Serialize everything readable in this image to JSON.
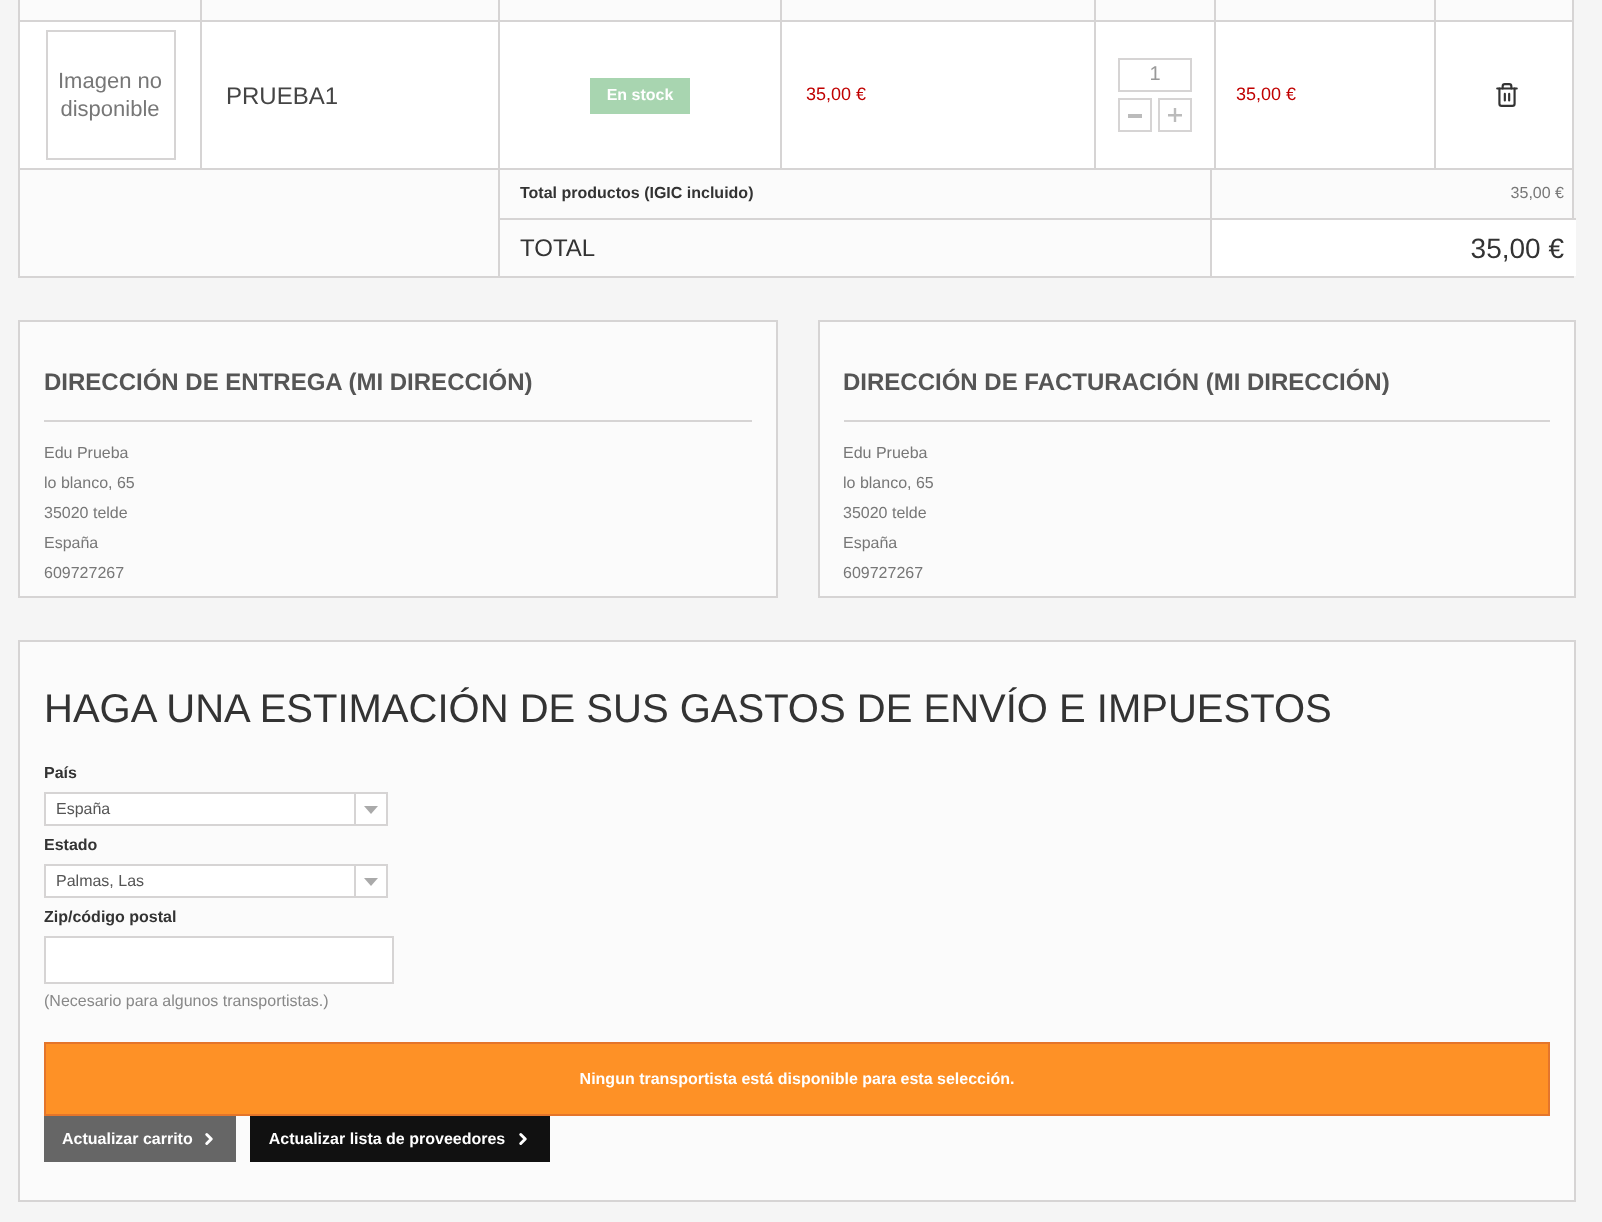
{
  "cart": {
    "items": [
      {
        "image_text": "Imagen no disponible",
        "description": "PRUEBA1",
        "availability": "En stock",
        "unit_price": "35,00 €",
        "quantity": "1",
        "total": "35,00 €"
      }
    ],
    "subtotal": {
      "label": "Total productos (IGIC incluido)",
      "value": "35,00 €"
    },
    "total": {
      "label": "TOTAL",
      "value": "35,00 €"
    }
  },
  "addresses": [
    {
      "title": "DIRECCIÓN DE ENTREGA (MI DIRECCIÓN)",
      "lines": [
        "Edu Prueba",
        "lo blanco, 65",
        "35020 telde",
        "España",
        "609727267"
      ]
    },
    {
      "title": "DIRECCIÓN DE FACTURACIÓN (MI DIRECCIÓN)",
      "lines": [
        "Edu Prueba",
        "lo blanco, 65",
        "35020 telde",
        "España",
        "609727267"
      ]
    }
  ],
  "estimate": {
    "title": "HAGA UNA ESTIMACIÓN DE SUS GASTOS DE ENVÍO E IMPUESTOS",
    "fields": [
      {
        "kind": "select",
        "label": "País",
        "value": "España"
      },
      {
        "kind": "select",
        "label": "Estado",
        "value": "Palmas, Las"
      },
      {
        "kind": "text",
        "label": "Zip/código postal",
        "help": "(Necesario para algunos transportistas.)"
      }
    ],
    "alert": "Ningun transportista está disponible para esta selección.",
    "buttons": [
      {
        "label": "Actualizar carrito",
        "kind": "secondary"
      },
      {
        "label": "Actualizar lista de proveedores",
        "kind": "primary"
      }
    ]
  }
}
